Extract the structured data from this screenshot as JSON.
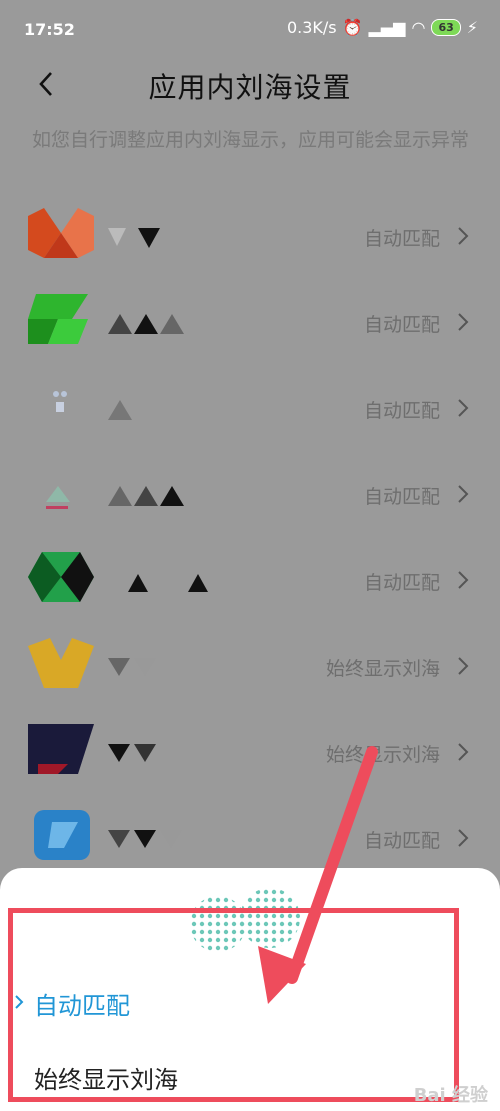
{
  "status_bar": {
    "time": "17:52",
    "network_speed": "0.3K/s",
    "battery": "63"
  },
  "header": {
    "title": "应用内刘海设置"
  },
  "description": "如您自行调整应用内刘海显示，应用可能会显示异常",
  "apps": [
    {
      "status": "自动匹配"
    },
    {
      "status": "自动匹配"
    },
    {
      "status": "自动匹配"
    },
    {
      "status": "自动匹配"
    },
    {
      "status": "自动匹配"
    },
    {
      "status": "始终显示刘海"
    },
    {
      "status": "始终显示刘海"
    },
    {
      "status": "自动匹配"
    }
  ],
  "sheet": {
    "options": [
      {
        "label": "自动匹配",
        "selected": true
      },
      {
        "label": "始终显示刘海",
        "selected": false
      }
    ]
  },
  "colors": {
    "accent": "#2196d6",
    "highlight": "#ee4c5c",
    "overlay": "#9a9a9a"
  }
}
